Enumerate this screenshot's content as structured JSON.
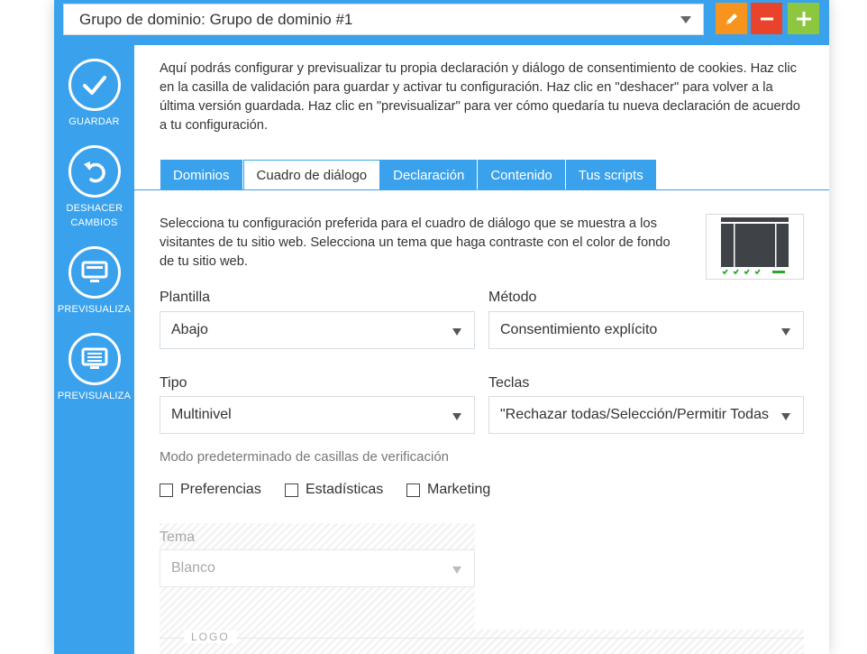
{
  "header": {
    "domain_group_value": "Grupo de dominio: Grupo de dominio #1"
  },
  "colors": {
    "accent": "#3aa2ec",
    "edit": "#f7941d",
    "remove": "#e9442b",
    "add": "#8dc63f",
    "check_green": "#2ea32e"
  },
  "sidebar": {
    "items": [
      {
        "label": "GUARDAR",
        "icon": "check-icon"
      },
      {
        "label": "DESHACER CAMBIOS",
        "icon": "undo-icon"
      },
      {
        "label": "PREVISUALIZA",
        "icon": "monitor-icon"
      },
      {
        "label": "PREVISUALIZA",
        "icon": "monitor-icon"
      }
    ]
  },
  "intro_text": "Aquí podrás configurar y previsualizar tu propia declaración y diálogo de consentimiento de cookies. Haz clic en la casilla de validación para guardar y activar tu configuración. Haz clic en \"deshacer\" para volver a la última versión guardada. Haz clic en \"previsualizar\" para ver cómo quedaría tu nueva declaración de acuerdo a tu configuración.",
  "tabs": [
    {
      "label": "Dominios",
      "active": false
    },
    {
      "label": "Cuadro de diálogo",
      "active": true
    },
    {
      "label": "Declaración",
      "active": false
    },
    {
      "label": "Contenido",
      "active": false
    },
    {
      "label": "Tus scripts",
      "active": false
    }
  ],
  "dialog_tab": {
    "description": "Selecciona tu configuración preferida para el cuadro de diálogo que se muestra a los visitantes de tu sitio web. Selecciona un tema que haga contraste con el color de fondo de tu sitio web.",
    "plantilla": {
      "label": "Plantilla",
      "value": "Abajo"
    },
    "metodo": {
      "label": "Método",
      "value": "Consentimiento explícito"
    },
    "tipo": {
      "label": "Tipo",
      "value": "Multinivel"
    },
    "teclas": {
      "label": "Teclas",
      "value": "\"Rechazar todas/Selección/Permitir Todas\""
    },
    "checkbox_heading": "Modo predeterminado de casillas de verificación",
    "checkboxes": [
      {
        "label": "Preferencias",
        "checked": false
      },
      {
        "label": "Estadísticas",
        "checked": false
      },
      {
        "label": "Marketing",
        "checked": false
      }
    ],
    "tema": {
      "label": "Tema",
      "value": "Blanco",
      "disabled": true
    },
    "logo_section": "LOGO"
  }
}
